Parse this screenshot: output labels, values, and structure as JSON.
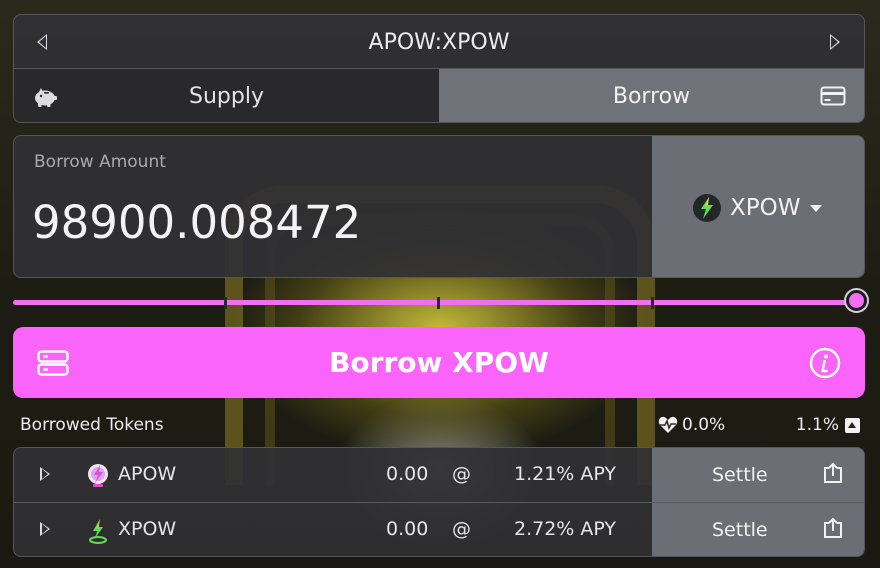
{
  "header": {
    "title": "APOW:XPOW"
  },
  "tabs": {
    "supply": "Supply",
    "borrow": "Borrow"
  },
  "amount": {
    "label": "Borrow Amount",
    "value": "98900.008472",
    "token": "XPOW"
  },
  "slider": {
    "value_fraction": 1.0
  },
  "action": {
    "label": "Borrow XPOW"
  },
  "borrowed": {
    "title": "Borrowed Tokens",
    "health": "0.0%",
    "limit": "1.1%",
    "rows": [
      {
        "symbol": "APOW",
        "amount": "0.00",
        "at": "@",
        "apy": "1.21% APY",
        "settle": "Settle"
      },
      {
        "symbol": "XPOW",
        "amount": "0.00",
        "at": "@",
        "apy": "2.72% APY",
        "settle": "Settle"
      }
    ]
  },
  "icons": {
    "prev": "chevron-left-icon",
    "next": "chevron-right-icon",
    "supply": "piggy-bank-icon",
    "borrow": "credit-card-icon",
    "action_left": "server-icon",
    "action_right": "info-icon",
    "health": "heart-pulse-icon",
    "settle": "upload-icon"
  },
  "colors": {
    "accent": "#fb64fa",
    "selected_tab": "#6f7379"
  }
}
